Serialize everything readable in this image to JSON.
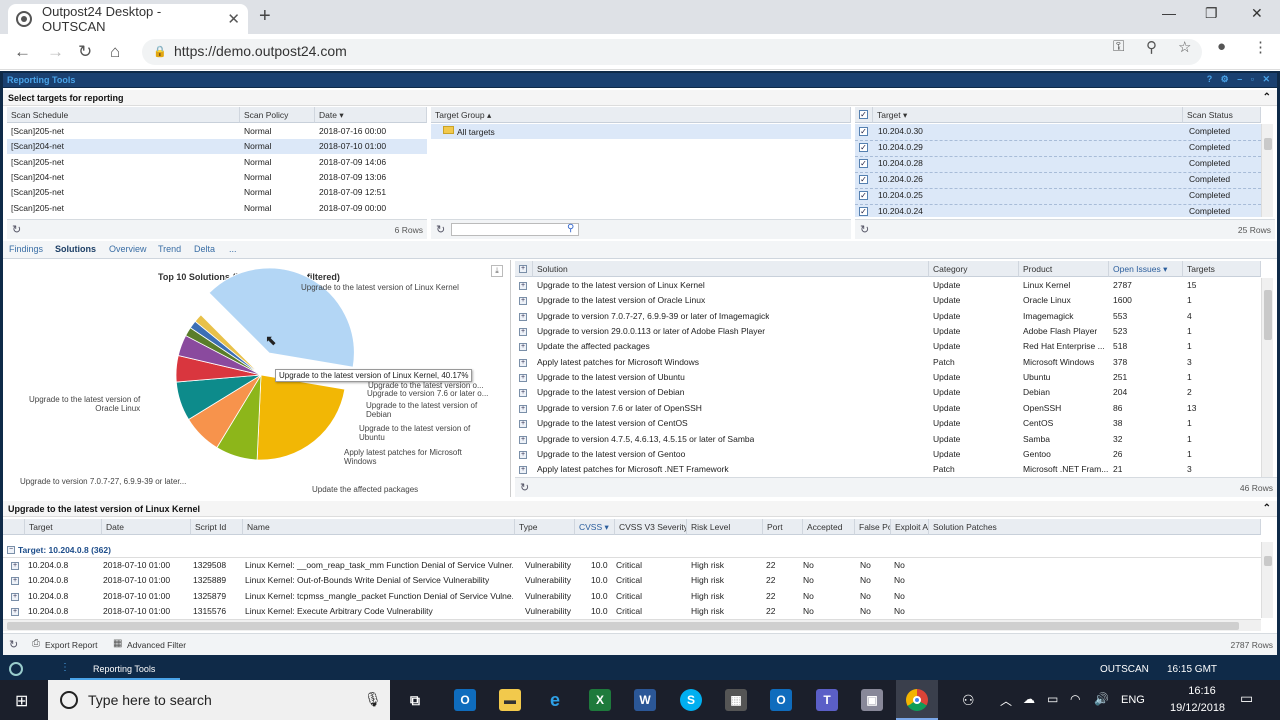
{
  "browser": {
    "tab_title": "Outpost24 Desktop - OUTSCAN",
    "url": "https://demo.outpost24.com"
  },
  "app": {
    "title": "Reporting Tools",
    "controls": "? ⚙ – ▫ ✕"
  },
  "targets_section": {
    "title": "Select targets for reporting",
    "schedule_headers": [
      "Scan Schedule",
      "Scan Policy",
      "Date ▾"
    ],
    "schedules": [
      [
        "[Scan]205-net",
        "Normal",
        "2018-07-16 00:00"
      ],
      [
        "[Scan]204-net",
        "Normal",
        "2018-07-10 01:00"
      ],
      [
        "[Scan]205-net",
        "Normal",
        "2018-07-09 14:06"
      ],
      [
        "[Scan]204-net",
        "Normal",
        "2018-07-09 13:06"
      ],
      [
        "[Scan]205-net",
        "Normal",
        "2018-07-09 12:51"
      ],
      [
        "[Scan]205-net",
        "Normal",
        "2018-07-09 00:00"
      ]
    ],
    "schedule_rows": "6 Rows",
    "group_header": "Target Group ▴",
    "group_item": "All targets",
    "target_headers": [
      "Target ▾",
      "Scan Status"
    ],
    "targets": [
      [
        "10.204.0.30",
        "Completed"
      ],
      [
        "10.204.0.29",
        "Completed"
      ],
      [
        "10.204.0.28",
        "Completed"
      ],
      [
        "10.204.0.26",
        "Completed"
      ],
      [
        "10.204.0.25",
        "Completed"
      ],
      [
        "10.204.0.24",
        "Completed"
      ]
    ],
    "target_rows": "25 Rows"
  },
  "tabs": [
    "Findings",
    "Solutions",
    "Overview",
    "Trend",
    "Delta",
    "..."
  ],
  "chart_data": {
    "type": "pie",
    "title": "Top 10 Solutions (Result has been filtered)",
    "tooltip": "Upgrade to the latest version of Linux Kernel, 40.17%",
    "slices": [
      {
        "label": "Upgrade to the latest version of Linux Kernel",
        "value": 40.17,
        "color": "#b3d6f5"
      },
      {
        "label": "Upgrade to the latest version of Oracle Linux",
        "value": 23.06,
        "color": "#f2b705"
      },
      {
        "label": "Upgrade to version 7.0.7-27, 6.9.9-39 or later...",
        "value": 7.96,
        "color": "#8db61a"
      },
      {
        "label": "Update the affected packages",
        "value": 7.54,
        "color": "#f7934c"
      },
      {
        "label": "Apply latest patches for Microsoft Windows",
        "value": 7.45,
        "color": "#0d8b8b"
      },
      {
        "label": "Upgrade to the latest version of Ubuntu",
        "value": 5.0,
        "color": "#d9363e"
      },
      {
        "label": "Upgrade to the latest version of Debian",
        "value": 4.0,
        "color": "#8a4a9e"
      },
      {
        "label": "Upgrade to version 7.6 or later o...",
        "value": 1.7,
        "color": "#5a7d2a"
      },
      {
        "label": "Upgrade to the latest version of...",
        "value": 1.5,
        "color": "#3c6fb5"
      },
      {
        "label": "",
        "value": 1.62,
        "color": "#e8c14a"
      }
    ]
  },
  "pie_labels": {
    "l1": "Upgrade to the latest version of Linux Kernel",
    "l2": "Upgrade to the latest version of\nOracle Linux",
    "l3": "Upgrade to version 7.0.7-27, 6.9.9-39 or later...",
    "l4": "Update the affected packages",
    "l5": "Apply latest patches for Microsoft\nWindows",
    "l6": "Upgrade to the latest version of\nUbuntu",
    "l7": "Upgrade to the latest version of\nDebian",
    "l8": "Upgrade to version 7.6 or later o...",
    "l9": "Upgrade to the latest version o..."
  },
  "solutions": {
    "headers": [
      "Solution",
      "Category",
      "Product",
      "Open Issues ▾",
      "Targets"
    ],
    "rows": [
      [
        "Upgrade to the latest version of Linux Kernel",
        "Update",
        "Linux Kernel",
        "2787",
        "15"
      ],
      [
        "Upgrade to the latest version of Oracle Linux",
        "Update",
        "Oracle Linux",
        "1600",
        "1"
      ],
      [
        "Upgrade to version 7.0.7-27, 6.9.9-39 or later of Imagemagick",
        "Update",
        "Imagemagick",
        "553",
        "4"
      ],
      [
        "Upgrade to version 29.0.0.113 or later of Adobe Flash Player",
        "Update",
        "Adobe Flash Player",
        "523",
        "1"
      ],
      [
        "Update the affected packages",
        "Update",
        "Red Hat Enterprise ...",
        "518",
        "1"
      ],
      [
        "Apply latest patches for Microsoft Windows",
        "Patch",
        "Microsoft Windows",
        "378",
        "3"
      ],
      [
        "Upgrade to the latest version of Ubuntu",
        "Update",
        "Ubuntu",
        "251",
        "1"
      ],
      [
        "Upgrade to the latest version of Debian",
        "Update",
        "Debian",
        "204",
        "2"
      ],
      [
        "Upgrade to version 7.6 or later of OpenSSH",
        "Update",
        "OpenSSH",
        "86",
        "13"
      ],
      [
        "Upgrade to the latest version of CentOS",
        "Update",
        "CentOS",
        "38",
        "1"
      ],
      [
        "Upgrade to version 4.7.5, 4.6.13, 4.5.15 or later of Samba",
        "Update",
        "Samba",
        "32",
        "1"
      ],
      [
        "Upgrade to the latest version of Gentoo",
        "Update",
        "Gentoo",
        "26",
        "1"
      ],
      [
        "Apply latest patches for Microsoft .NET Framework",
        "Patch",
        "Microsoft .NET Fram...",
        "21",
        "3"
      ]
    ],
    "rows_count": "46 Rows"
  },
  "findings": {
    "title": "Upgrade to the latest version of Linux Kernel",
    "headers": [
      "Target",
      "Date",
      "Script Id",
      "Name",
      "Type",
      "CVSS ▾",
      "CVSS V3 Severity",
      "Risk Level",
      "Port",
      "Accepted",
      "False Pos",
      "Exploit A",
      "Solution Patches"
    ],
    "group": "Target: 10.204.0.8 (362)",
    "rows": [
      [
        "10.204.0.8",
        "2018-07-10 01:00",
        "1329508",
        "Linux Kernel: __oom_reap_task_mm Function Denial of Service Vulner...",
        "Vulnerability",
        "10.0",
        "Critical",
        "High risk",
        "22",
        "No",
        "No",
        "No"
      ],
      [
        "10.204.0.8",
        "2018-07-10 01:00",
        "1325889",
        "Linux Kernel: Out-of-Bounds Write Denial of Service Vulnerability",
        "Vulnerability",
        "10.0",
        "Critical",
        "High risk",
        "22",
        "No",
        "No",
        "No"
      ],
      [
        "10.204.0.8",
        "2018-07-10 01:00",
        "1325879",
        "Linux Kernel: tcpmss_mangle_packet Function Denial of Service Vulne...",
        "Vulnerability",
        "10.0",
        "Critical",
        "High risk",
        "22",
        "No",
        "No",
        "No"
      ],
      [
        "10.204.0.8",
        "2018-07-10 01:00",
        "1315576",
        "Linux Kernel: Execute Arbitrary Code Vulnerability",
        "Vulnerability",
        "10.0",
        "Critical",
        "High risk",
        "22",
        "No",
        "No",
        "No"
      ]
    ],
    "export": "Export Report",
    "filter": "Advanced Filter",
    "rows_count": "2787 Rows"
  },
  "status": {
    "tab": "Reporting Tools",
    "product": "OUTSCAN",
    "time": "16:15 GMT"
  },
  "taskbar": {
    "search": "Type here to search",
    "lang": "ENG",
    "clock_time": "16:16",
    "clock_date": "19/12/2018"
  }
}
